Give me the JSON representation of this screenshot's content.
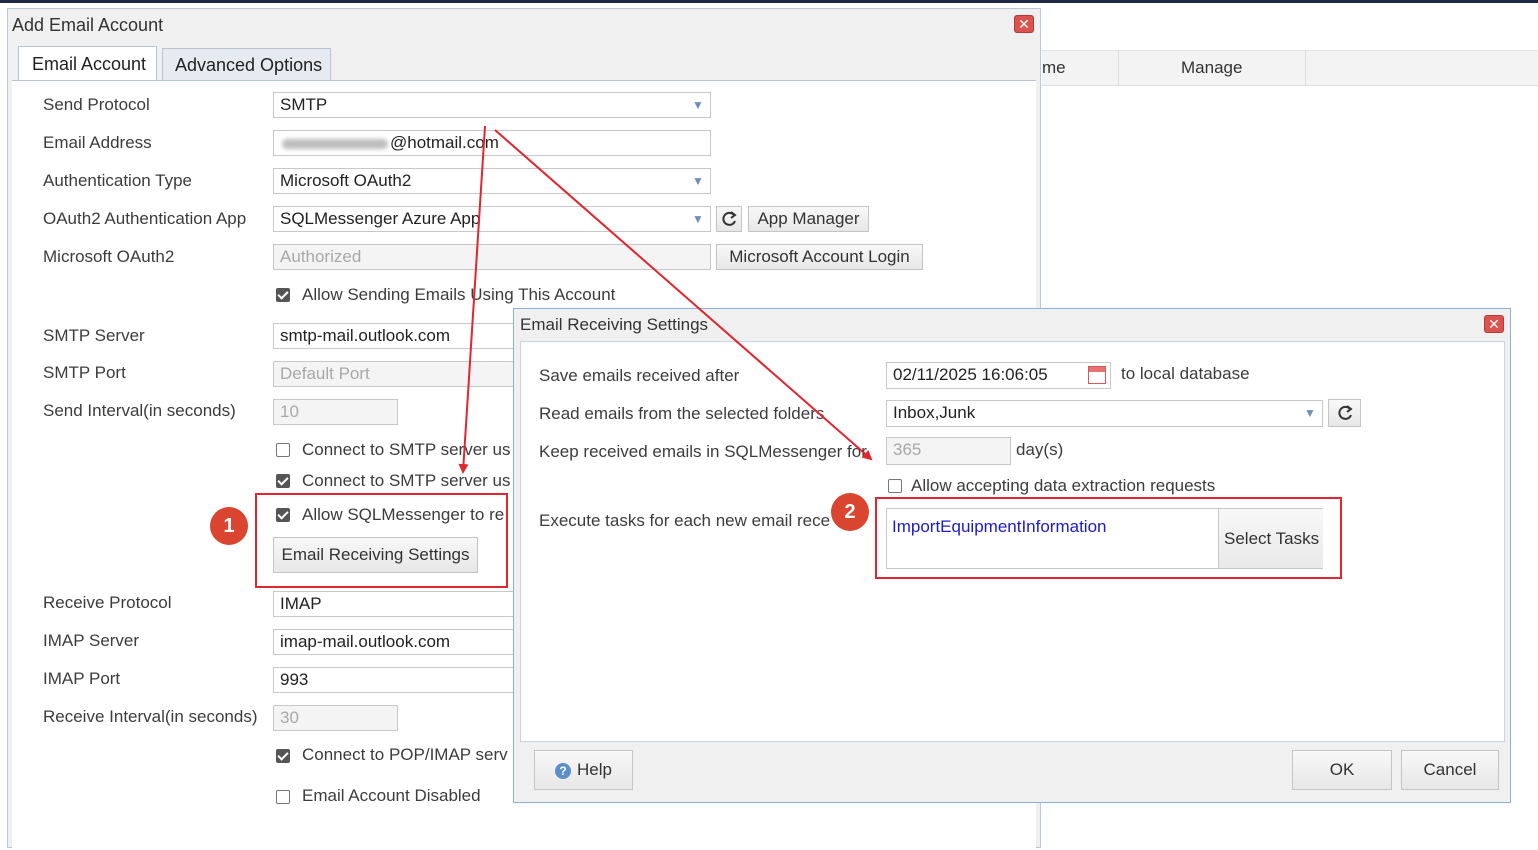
{
  "background": {
    "grid_headers": [
      "me",
      "Manage"
    ]
  },
  "add_dialog": {
    "title": "Add Email Account",
    "tabs": [
      "Email Account",
      "Advanced Options"
    ],
    "fields": {
      "send_protocol": {
        "label": "Send Protocol",
        "value": "SMTP"
      },
      "email_address": {
        "label": "Email Address",
        "value": "@hotmail.com"
      },
      "auth_type": {
        "label": "Authentication Type",
        "value": "Microsoft OAuth2"
      },
      "oauth_app": {
        "label": "OAuth2 Authentication App",
        "value": "SQLMessenger Azure App",
        "button": "App Manager"
      },
      "ms_oauth": {
        "label": "Microsoft OAuth2",
        "value": "Authorized",
        "button": "Microsoft Account Login"
      },
      "allow_sending": {
        "label": "Allow Sending Emails Using This Account",
        "checked": true
      },
      "smtp_server": {
        "label": "SMTP Server",
        "value": "smtp-mail.outlook.com"
      },
      "smtp_port": {
        "label": "SMTP Port",
        "placeholder": "Default Port"
      },
      "send_interval": {
        "label": "Send Interval(in seconds)",
        "value": "10"
      },
      "smtp_opt1": {
        "label": "Connect to SMTP server us",
        "checked": false
      },
      "smtp_opt2": {
        "label": "Connect to SMTP server us",
        "checked": true
      },
      "allow_receive": {
        "label": "Allow SQLMessenger to re",
        "checked": true
      },
      "email_receiving_button": "Email Receiving Settings",
      "receive_protocol": {
        "label": "Receive Protocol",
        "value": "IMAP"
      },
      "imap_server": {
        "label": "IMAP Server",
        "value": "imap-mail.outlook.com"
      },
      "imap_port": {
        "label": "IMAP Port",
        "value": "993"
      },
      "receive_interval": {
        "label": "Receive Interval(in seconds)",
        "value": "30"
      },
      "pop_imap_opt": {
        "label": "Connect to POP/IMAP serv",
        "checked": true
      },
      "disabled_opt": {
        "label": "Email Account Disabled",
        "checked": false
      }
    }
  },
  "receiving_dialog": {
    "title": "Email Receiving Settings",
    "save_after": {
      "label": "Save emails received after",
      "value": "02/11/2025 16:06:05",
      "suffix": "to local database"
    },
    "folders": {
      "label": "Read emails from the selected folders",
      "value": "Inbox,Junk"
    },
    "keep": {
      "label": "Keep received emails in SQLMessenger for",
      "value": "365",
      "suffix": "day(s)"
    },
    "allow_extraction": {
      "label": "Allow accepting data extraction requests",
      "checked": false
    },
    "tasks": {
      "label": "Execute tasks for each new email rece",
      "value": "ImportEquipmentInformation",
      "button": "Select Tasks"
    },
    "buttons": {
      "help": "Help",
      "ok": "OK",
      "cancel": "Cancel"
    }
  },
  "annotations": {
    "badge1": "1",
    "badge2": "2"
  },
  "colors": {
    "accent_red": "#e0262f",
    "badge": "#d9452e",
    "link_blue": "#1a1ad0"
  },
  "icons": [
    "chevron-down-icon",
    "refresh-icon",
    "calendar-icon",
    "help-icon",
    "close-icon"
  ]
}
